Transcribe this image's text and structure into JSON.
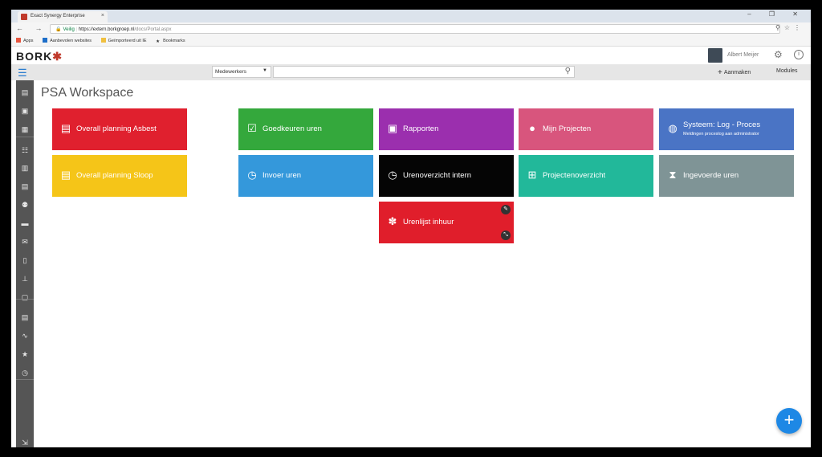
{
  "browser": {
    "tab_title": "Exact Synergy Enterprise",
    "tab_close": "×",
    "window_controls": "– ❐ ✕",
    "nav_buttons": "← → C",
    "secure_label": "Veilig",
    "url_host": "https://extern.borkgroep.nl",
    "url_path": "/docs/Portal.aspx",
    "bookmarks": [
      "Apps",
      "Aanbevolen websites",
      "Geïmporteerd uit IE",
      "Bookmarks"
    ]
  },
  "app": {
    "logo_text": "BORK",
    "user_name": "Albert Meijer",
    "info_icon": "i"
  },
  "toolbar": {
    "select_value": "Medewerkers",
    "create_label": "Aanmaken",
    "modules_label": "Modules"
  },
  "sidebar": {
    "icons": [
      "list-icon",
      "dashboard-icon",
      "grid-icon",
      "tasks-icon",
      "calendar-icon",
      "document-icon",
      "people-icon",
      "card-icon",
      "mail-icon",
      "book-icon",
      "hierarchy-icon",
      "box-icon",
      "report-icon",
      "chart-icon",
      "star-icon",
      "clock-icon",
      "collapse-icon"
    ]
  },
  "page": {
    "title": "PSA Workspace"
  },
  "tiles": [
    {
      "label": "Overall planning Asbest",
      "icon": "table-icon",
      "color": "#e0202e"
    },
    {
      "label": "Overall planning Sloop",
      "icon": "table-icon",
      "color": "#f5c518"
    },
    {
      "label": "Goedkeuren uren",
      "icon": "approve-hours-icon",
      "color": "#34a83c"
    },
    {
      "label": "Invoer uren",
      "icon": "hours-entry-icon",
      "color": "#3498db"
    },
    {
      "label": "Rapporten",
      "icon": "reports-icon",
      "color": "#9b2fae"
    },
    {
      "label": "Urenoverzicht intern",
      "icon": "clock-icon",
      "color": "#050505"
    },
    {
      "label": "Urenlijst inhuur",
      "icon": "people-icon",
      "color": "#e01e2b"
    },
    {
      "label": "Mijn Projecten",
      "icon": "person-icon",
      "color": "#d8557d"
    },
    {
      "label": "Projectenoverzicht",
      "icon": "hierarchy-icon",
      "color": "#22b89a"
    },
    {
      "label": "Systeem: Log - Proces",
      "sub": "Meldingen proceslog aan administrator",
      "icon": "globe-icon",
      "color": "#4a74c5"
    },
    {
      "label": "Ingevoerde uren",
      "icon": "hourglass-icon",
      "color": "#7f9496"
    }
  ],
  "fab_label": "+"
}
